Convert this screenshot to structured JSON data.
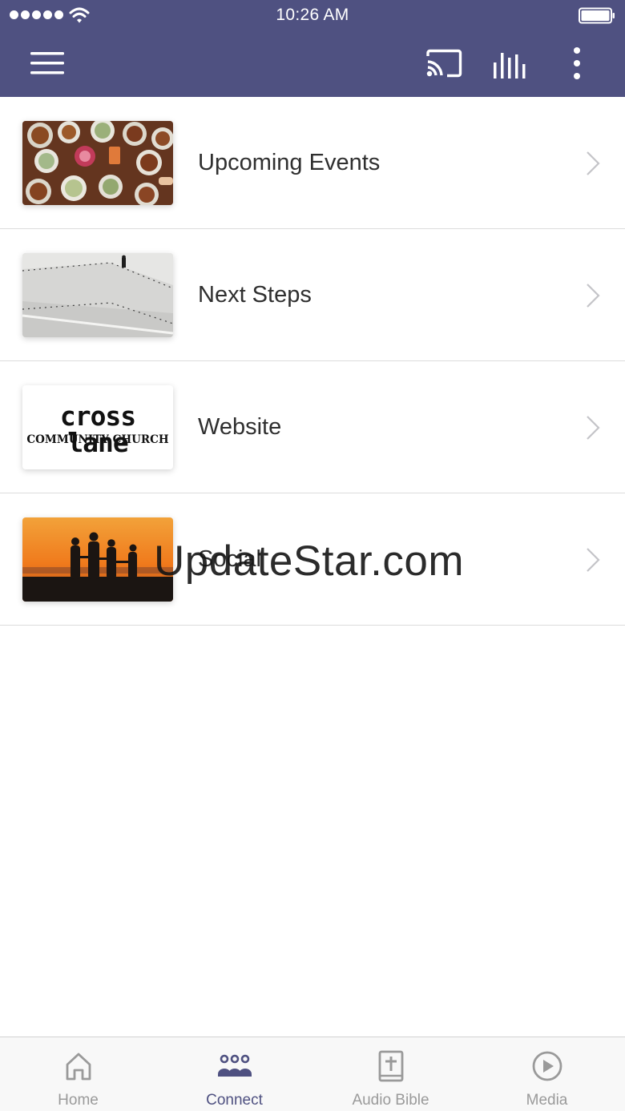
{
  "status_bar": {
    "time": "10:26 AM"
  },
  "header": {
    "background_color": "#4f5181",
    "menu_icon": "hamburger-menu-icon",
    "cast_icon": "cast-icon",
    "bars_icon": "audio-bars-icon",
    "more_icon": "more-vertical-icon"
  },
  "list": {
    "items": [
      {
        "label": "Upcoming Events",
        "thumbnail": "food-table-photo"
      },
      {
        "label": "Next Steps",
        "thumbnail": "staircase-photo"
      },
      {
        "label": "Website",
        "thumbnail": "cross-lane-logo"
      },
      {
        "label": "Social",
        "thumbnail": "sunset-family-photo"
      }
    ]
  },
  "website_logo": {
    "main": "cross lane",
    "sub": "COMMUNITY CHURCH"
  },
  "watermark": "UpdateStar.com",
  "tabbar": {
    "active_color": "#4f5181",
    "tabs": [
      {
        "label": "Home",
        "icon": "home-icon"
      },
      {
        "label": "Connect",
        "icon": "people-group-icon"
      },
      {
        "label": "Audio Bible",
        "icon": "bible-icon"
      },
      {
        "label": "Media",
        "icon": "play-circle-icon"
      }
    ]
  }
}
